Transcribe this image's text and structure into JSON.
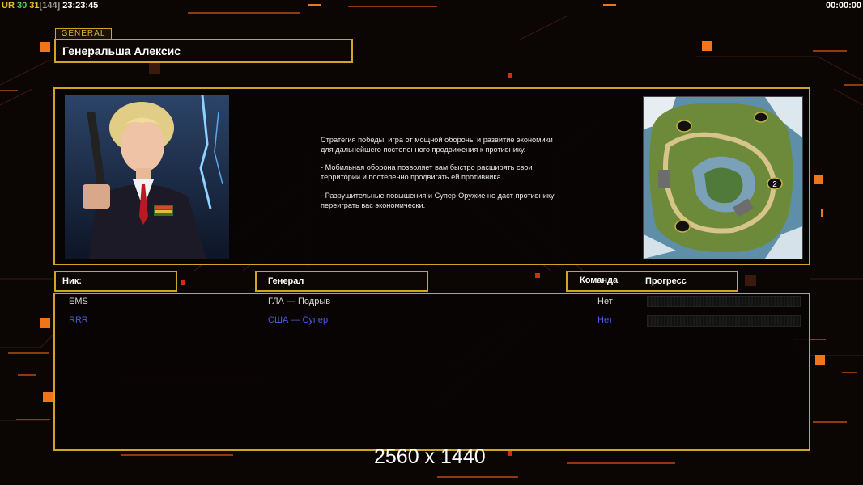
{
  "hud": {
    "ur": "UR",
    "n1": "30",
    "n2": "31",
    "n3": "[144]",
    "clock": "23:23:45",
    "timer": "00:00:00"
  },
  "general_tag": "GENERAL",
  "general_name": "Генеральша Алексис",
  "strategy": [
    "Стратегия победы: игра от мощной обороны и развитие экономики для дальнейшего постепенного продвижения к противнику.",
    "- Мобильная оборона позволяет вам быстро расширять свои территории и постепенно продвигать ей противника.",
    "- Разрушительные повышения и Супер-Оружие не даст противнику переиграть вас экономически."
  ],
  "minimap": {
    "marker": "2"
  },
  "headers": {
    "nick": "Ник:",
    "general": "Генерал",
    "team": "Команда",
    "progress": "Прогресс"
  },
  "players": [
    {
      "nick": "EMS",
      "general": "ГЛА — Подрыв",
      "team": "Нет",
      "color": "#d8d8d8"
    },
    {
      "nick": "RRR",
      "general": "США — Супер",
      "team": "Нет",
      "color": "#4a5de0"
    }
  ],
  "watermark": "2560 x 1440",
  "colors": {
    "accent": "#cfa521",
    "orange": "#f07418",
    "blue_player": "#4a5de0"
  }
}
